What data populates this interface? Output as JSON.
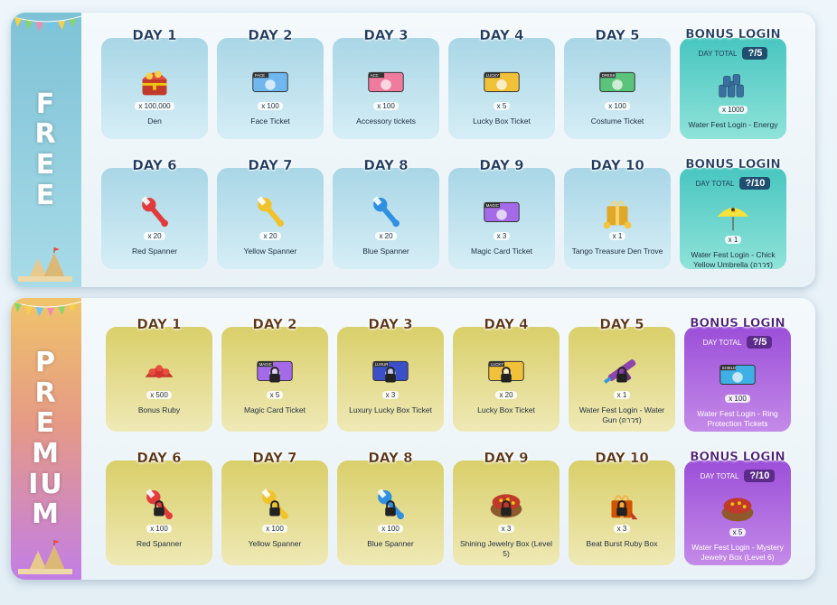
{
  "free": {
    "title": "FREE",
    "days": [
      {
        "label": "DAY 1",
        "qty": "x 100,000",
        "name": "Den",
        "icon": "treasure-chest"
      },
      {
        "label": "DAY 2",
        "qty": "x 100",
        "name": "Face Ticket",
        "icon": "ticket",
        "tag": "FACE",
        "color": "#6fb7ef"
      },
      {
        "label": "DAY 3",
        "qty": "x 100",
        "name": "Accessory tickets",
        "icon": "ticket",
        "tag": "ACC",
        "color": "#ef7c9e"
      },
      {
        "label": "DAY 4",
        "qty": "x 5",
        "name": "Lucky Box Ticket",
        "icon": "ticket",
        "tag": "LUCKY",
        "color": "#f2c13a"
      },
      {
        "label": "DAY 5",
        "qty": "x 100",
        "name": "Costume Ticket",
        "icon": "ticket",
        "tag": "DRESS",
        "color": "#5ac47a"
      },
      {
        "label": "DAY 6",
        "qty": "x 20",
        "name": "Red Spanner",
        "icon": "spanner",
        "color": "#e23b3b"
      },
      {
        "label": "DAY 7",
        "qty": "x 20",
        "name": "Yellow Spanner",
        "icon": "spanner",
        "color": "#f2c22a"
      },
      {
        "label": "DAY 8",
        "qty": "x 20",
        "name": "Blue Spanner",
        "icon": "spanner",
        "color": "#2f8fe0"
      },
      {
        "label": "DAY 9",
        "qty": "x 3",
        "name": "Magic Card Ticket",
        "icon": "ticket",
        "tag": "MAGIC",
        "color": "#a46ae8"
      },
      {
        "label": "DAY 10",
        "qty": "x 1",
        "name": "Tango Treasure Den Trove",
        "icon": "gold-box"
      }
    ],
    "bonus": [
      {
        "label": "BONUS LOGIN",
        "total_label": "DAY TOTAL",
        "total": "?/5",
        "qty": "x 1000",
        "name": "Water Fest Login - Energy",
        "icon": "energy-pile"
      },
      {
        "label": "BONUS LOGIN",
        "total_label": "DAY TOTAL",
        "total": "?/10",
        "qty": "x 1",
        "name": "Water Fest Login - Chick Yellow Umbrella (ถาวร)",
        "icon": "umbrella"
      }
    ]
  },
  "premium": {
    "title": "PREMIUM",
    "days": [
      {
        "label": "DAY 1",
        "qty": "x 500",
        "name": "Bonus Ruby",
        "icon": "ruby"
      },
      {
        "label": "DAY 2",
        "qty": "x 5",
        "name": "Magic Card Ticket",
        "icon": "ticket",
        "tag": "MAGIC",
        "color": "#a46ae8",
        "locked": true
      },
      {
        "label": "DAY 3",
        "qty": "x 3",
        "name": "Luxury Lucky Box Ticket",
        "icon": "ticket",
        "tag": "LUXUR",
        "color": "#3b4fc8",
        "locked": true
      },
      {
        "label": "DAY 4",
        "qty": "x 20",
        "name": "Lucky Box Ticket",
        "icon": "ticket",
        "tag": "LUCKY",
        "color": "#f2c13a",
        "locked": true
      },
      {
        "label": "DAY 5",
        "qty": "x 1",
        "name": "Water Fest Login - Water Gun (ถาวร)",
        "icon": "water-gun",
        "locked": true
      },
      {
        "label": "DAY 6",
        "qty": "x 100",
        "name": "Red Spanner",
        "icon": "spanner",
        "color": "#e23b3b",
        "locked": true
      },
      {
        "label": "DAY 7",
        "qty": "x 100",
        "name": "Yellow Spanner",
        "icon": "spanner",
        "color": "#f2c22a",
        "locked": true
      },
      {
        "label": "DAY 8",
        "qty": "x 100",
        "name": "Blue Spanner",
        "icon": "spanner",
        "color": "#2f8fe0",
        "locked": true
      },
      {
        "label": "DAY 9",
        "qty": "x 3",
        "name": "Shining Jewelry Box (Level 5)",
        "icon": "jewelry-box",
        "locked": true
      },
      {
        "label": "DAY 10",
        "qty": "x 3",
        "name": "Beat Burst Ruby Box",
        "icon": "gift-box",
        "locked": true
      }
    ],
    "bonus": [
      {
        "label": "BONUS LOGIN",
        "total_label": "DAY TOTAL",
        "total": "?/5",
        "qty": "x 100",
        "name": "Water Fest Login - Ring Protection Tickets",
        "icon": "ticket",
        "tag": "SHIELD",
        "color": "#3fb0e6"
      },
      {
        "label": "BONUS LOGIN",
        "total_label": "DAY TOTAL",
        "total": "?/10",
        "qty": "x 5",
        "name": "Water Fest Login - Mystery Jewelry Box (Level 6)",
        "icon": "jewelry-box"
      }
    ]
  }
}
